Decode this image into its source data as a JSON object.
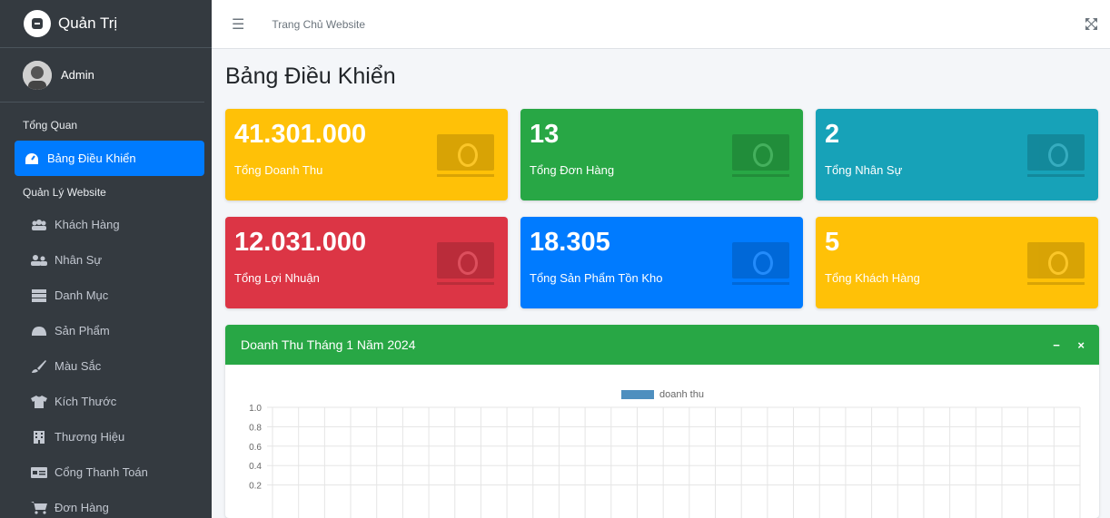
{
  "brand": {
    "title": "Quản Trị"
  },
  "user": {
    "name": "Admin"
  },
  "sidebar": {
    "header1": "Tổng Quan",
    "header2": "Quản Lý Website",
    "items": [
      {
        "label": "Bảng Điều Khiển",
        "icon": "dashboard-icon"
      },
      {
        "label": "Khách Hàng",
        "icon": "users-icon"
      },
      {
        "label": "Nhân Sự",
        "icon": "staff-icon"
      },
      {
        "label": "Danh Mục",
        "icon": "list-icon"
      },
      {
        "label": "Sản Phẩm",
        "icon": "product-icon"
      },
      {
        "label": "Màu Sắc",
        "icon": "brush-icon"
      },
      {
        "label": "Kích Thước",
        "icon": "shirt-icon"
      },
      {
        "label": "Thương Hiệu",
        "icon": "building-icon"
      },
      {
        "label": "Cổng Thanh Toán",
        "icon": "payment-icon"
      },
      {
        "label": "Đơn Hàng",
        "icon": "cart-icon"
      }
    ]
  },
  "topbar": {
    "link": "Trang Chủ Website"
  },
  "page": {
    "title": "Bảng Điều Khiển"
  },
  "stats": [
    {
      "value": "41.301.000",
      "label": "Tổng Doanh Thu",
      "color": "#ffc107"
    },
    {
      "value": "13",
      "label": "Tổng Đơn Hàng",
      "color": "#28a745"
    },
    {
      "value": "2",
      "label": "Tổng Nhân Sự",
      "color": "#17a2b8"
    },
    {
      "value": "12.031.000",
      "label": "Tổng Lợi Nhuận",
      "color": "#dc3545"
    },
    {
      "value": "18.305",
      "label": "Tổng Sản Phẩm Tồn Kho",
      "color": "#007bff"
    },
    {
      "value": "5",
      "label": "Tổng Khách Hàng",
      "color": "#ffc107"
    }
  ],
  "card": {
    "title": "Doanh Thu Tháng 1 Năm 2024",
    "minimize": "−",
    "close": "×"
  },
  "chart_data": {
    "type": "bar",
    "series": [
      {
        "name": "doanh thu",
        "values": []
      }
    ],
    "yticks": [
      "1.0",
      "0.8",
      "0.6",
      "0.4",
      "0.2"
    ],
    "ylim": [
      0,
      1
    ],
    "grid": true,
    "legend": "top-center",
    "color": "#4e8fbf"
  }
}
